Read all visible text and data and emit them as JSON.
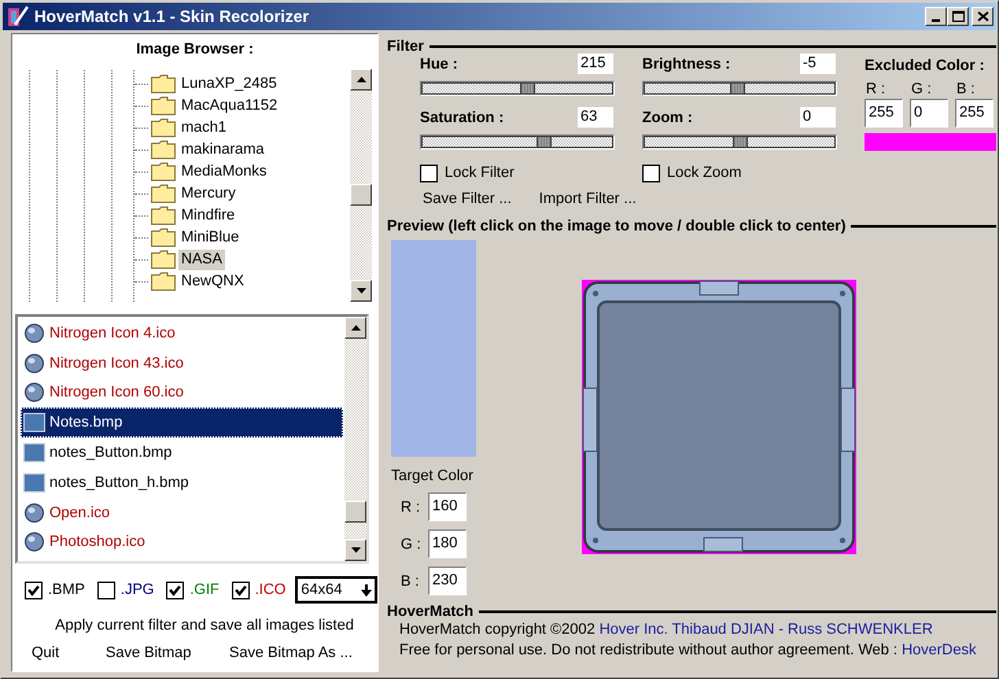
{
  "window": {
    "title": "HoverMatch v1.1 - Skin Recolorizer"
  },
  "image_browser": {
    "title": "Image Browser :",
    "folders": [
      {
        "name": "LunaXP_2485",
        "selected": false
      },
      {
        "name": "MacAqua1152",
        "selected": false
      },
      {
        "name": "mach1",
        "selected": false
      },
      {
        "name": "makinarama",
        "selected": false
      },
      {
        "name": "MediaMonks",
        "selected": false
      },
      {
        "name": "Mercury",
        "selected": false
      },
      {
        "name": "Mindfire",
        "selected": false
      },
      {
        "name": "MiniBlue",
        "selected": false
      },
      {
        "name": "NASA",
        "selected": true
      },
      {
        "name": "NewQNX",
        "selected": false
      }
    ],
    "files": [
      {
        "name": "Nitrogen Icon 4.ico",
        "kind": "ico",
        "selected": false
      },
      {
        "name": "Nitrogen Icon 43.ico",
        "kind": "ico",
        "selected": false
      },
      {
        "name": "Nitrogen Icon 60.ico",
        "kind": "ico",
        "selected": false
      },
      {
        "name": "Notes.bmp",
        "kind": "bmp",
        "selected": true
      },
      {
        "name": "notes_Button.bmp",
        "kind": "bmp",
        "selected": false
      },
      {
        "name": "notes_Button_h.bmp",
        "kind": "bmp",
        "selected": false
      },
      {
        "name": "Open.ico",
        "kind": "ico",
        "selected": false
      },
      {
        "name": "Photoshop.ico",
        "kind": "ico",
        "selected": false
      }
    ],
    "type_filters": [
      {
        "label": ".BMP",
        "checked": true,
        "color": "#000000"
      },
      {
        "label": ".JPG",
        "checked": false,
        "color": "#000080"
      },
      {
        "label": ".GIF",
        "checked": true,
        "color": "#008000"
      },
      {
        "label": ".ICO",
        "checked": true,
        "color": "#c00000"
      }
    ],
    "size": {
      "value": "64x64"
    },
    "apply_all": "Apply current filter and save all images listed",
    "buttons": [
      "Quit",
      "Save Bitmap",
      "Save Bitmap As ..."
    ]
  },
  "filter": {
    "title": "Filter",
    "sliders": [
      {
        "label": "Hue :",
        "value": "215",
        "level": 0.56
      },
      {
        "label": "Brightness :",
        "value": "-5",
        "level": 0.49
      },
      {
        "label": "Saturation :",
        "value": "63",
        "level": 0.65
      },
      {
        "label": "Zoom :",
        "value": "0",
        "level": 0.5
      }
    ],
    "locks": [
      {
        "label": "Lock Filter",
        "checked": false
      },
      {
        "label": "Lock Zoom",
        "checked": false
      }
    ],
    "buttons": [
      "Save Filter ...",
      "Import Filter ..."
    ],
    "excluded_color": {
      "title": "Excluded Color :",
      "color": "#ff00ff",
      "channels": [
        {
          "label": "R :",
          "value": "255"
        },
        {
          "label": "G :",
          "value": "0"
        },
        {
          "label": "B :",
          "value": "255"
        }
      ]
    }
  },
  "preview": {
    "title": "Preview (left click on the image to move / double click to center)",
    "target_color": {
      "label": "Target Color",
      "color": "#a0b4e6",
      "channels": [
        {
          "label": "R :",
          "value": "160"
        },
        {
          "label": "G :",
          "value": "180"
        },
        {
          "label": "B :",
          "value": "230"
        }
      ]
    }
  },
  "about": {
    "title": "HoverMatch",
    "lines": [
      {
        "text": "HoverMatch copyright ©2002",
        "link": "Hover Inc. Thibaud DJIAN - Russ SCHWENKLER"
      },
      {
        "text": "Free for personal use. Do not redistribute without author agreement. Web :",
        "link": "HoverDesk"
      }
    ]
  }
}
